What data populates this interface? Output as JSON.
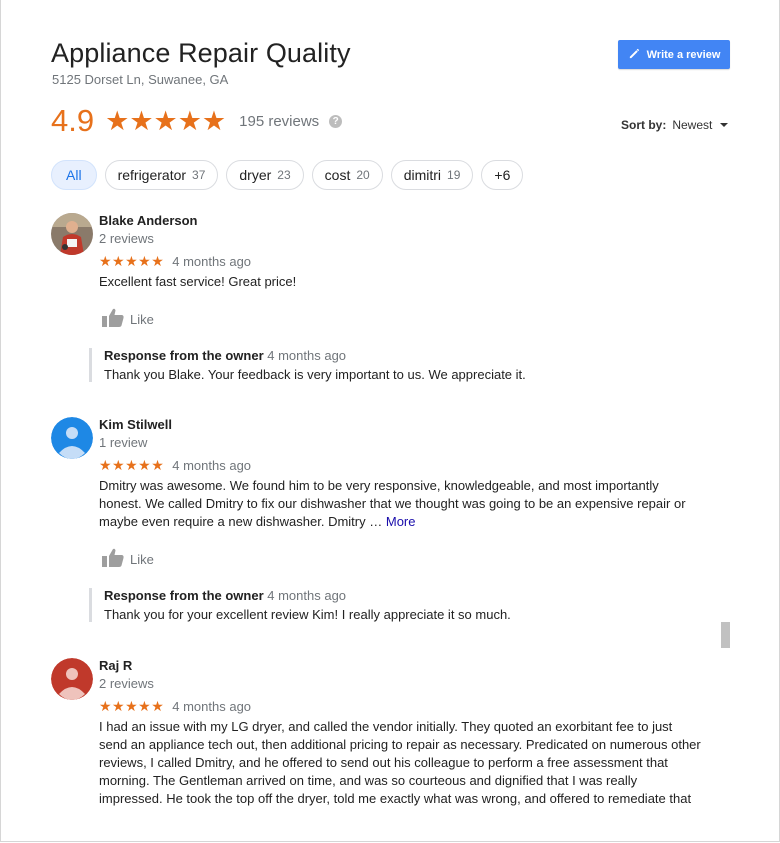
{
  "business": {
    "title": "Appliance Repair Quality",
    "address": "5125 Dorset Ln, Suwanee, GA",
    "write_review_label": "Write a review",
    "rating": "4.9",
    "stars": "★★★★★",
    "reviews_count": "195 reviews",
    "help_glyph": "?"
  },
  "sort": {
    "label": "Sort by:",
    "value": "Newest"
  },
  "chips": [
    {
      "label": "All",
      "count": ""
    },
    {
      "label": "refrigerator",
      "count": "37"
    },
    {
      "label": "dryer",
      "count": "23"
    },
    {
      "label": "cost",
      "count": "20"
    },
    {
      "label": "dimitri",
      "count": "19"
    },
    {
      "label": "+6",
      "count": ""
    }
  ],
  "reviews": [
    {
      "name": "Blake Anderson",
      "subcount": "2 reviews",
      "stars": "★★★★★",
      "date": "4 months ago",
      "text": "Excellent fast service! Great price!",
      "more": "",
      "like_label": "Like",
      "owner_label": "Response from the owner",
      "owner_date": "4 months ago",
      "owner_text": "Thank you Blake. Your feedback is very important to us. We appreciate it."
    },
    {
      "name": "Kim Stilwell",
      "subcount": "1 review",
      "stars": "★★★★★",
      "date": "4 months ago",
      "text": "Dmitry was awesome. We found him to be very responsive, knowledgeable, and most importantly honest.  We called Dmitry to fix our dishwasher that we thought was going to be an expensive repair or maybe even require a new dishwasher.  Dmitry …",
      "more": "More",
      "like_label": "Like",
      "owner_label": "Response from the owner",
      "owner_date": "4 months ago",
      "owner_text": "Thank you for your excellent review Kim! I really appreciate it so much."
    },
    {
      "name": "Raj R",
      "subcount": "2 reviews",
      "stars": "★★★★★",
      "date": "4 months ago",
      "text": "I had an issue with my LG dryer, and called the vendor initially. They quoted an exorbitant fee to just send an appliance tech out, then additional pricing to repair as necessary. Predicated on numerous other reviews, I called Dmitry, and he offered to send out his colleague to perform a free assessment that morning. The Gentleman arrived on time, and was so courteous and dignified that I was really impressed. He took the top off the dryer, told me exactly what was wrong, and offered to remediate that"
    }
  ],
  "colors": {
    "accent_orange": "#e7711b",
    "button_blue": "#4285f4",
    "link_blue": "#1a0dab",
    "chip_active_bg": "#e8f0fe"
  }
}
